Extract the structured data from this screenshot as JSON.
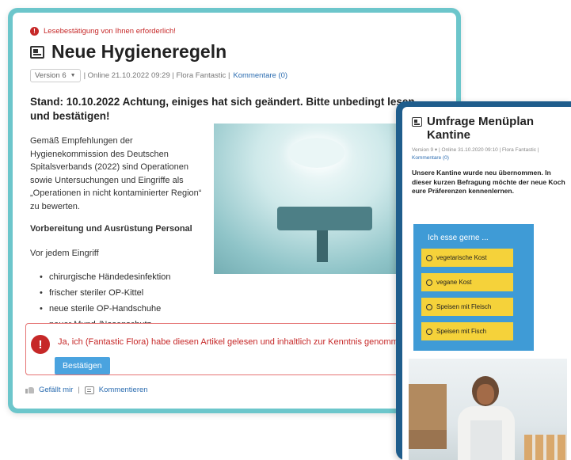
{
  "article": {
    "warning": "Lesebestätigung von Ihnen erforderlich!",
    "warning_icon": "!",
    "title": "Neue Hygieneregeln",
    "version": "Version 6",
    "online": "| Online 21.10.2022 09:29 | Flora Fantastic |",
    "comments_link": "Kommentare (0)",
    "stand": "Stand: 10.10.2022 Achtung, einiges hat sich geändert. Bitte unbedingt lesen und bestätigen!",
    "intro": "Gemäß Empfehlungen der Hygienekommission des Deutschen Spitalsverbands (2022) sind Operationen sowie Untersuchungen und Eingriffe als „Operationen in nicht kontaminierter Region“ zu bewerten.",
    "subheading": "Vorbereitung und Ausrüstung Personal",
    "before_text": "Vor jedem Eingriff",
    "bullets": [
      "chirurgische Händedesinfektion",
      "frischer steriler OP-Kittel",
      "neue sterile OP-Handschuhe",
      "neuer Mund-/Nasenschutz"
    ],
    "confirm_icon": "!",
    "confirm_text": "Ja, ich (Fantastic Flora) habe diesen Artikel gelesen und inhaltlich zur Kenntnis genommen.",
    "confirm_button": "Bestätigen",
    "like_label": "Gefällt mir",
    "separator": "|",
    "comment_label": "Kommentieren"
  },
  "survey_post": {
    "title": "Umfrage Menüplan Kantine",
    "version": "Version 9",
    "online": "| Online 31.10.2020 09:10 | Flora Fantastic |",
    "comments_link": "Kommentare (0)",
    "intro": "Unsere Kantine wurde neu übernommen. In dieser kurzen Befragung möchte der neue Koch eure Präferenzen kennenlernen.",
    "question": "Ich esse gerne ...",
    "options": [
      "vegetarische Kost",
      "vegane Kost",
      "Speisen mit Fleisch",
      "Speisen mit Fisch"
    ]
  },
  "colors": {
    "frame1": "#6cc6cb",
    "frame2": "#1f5d8c",
    "warning": "#c62828",
    "link": "#2b6cb0",
    "button": "#4aa3df",
    "survey_bg": "#3f9bd6",
    "option_bg": "#f5d23a"
  }
}
